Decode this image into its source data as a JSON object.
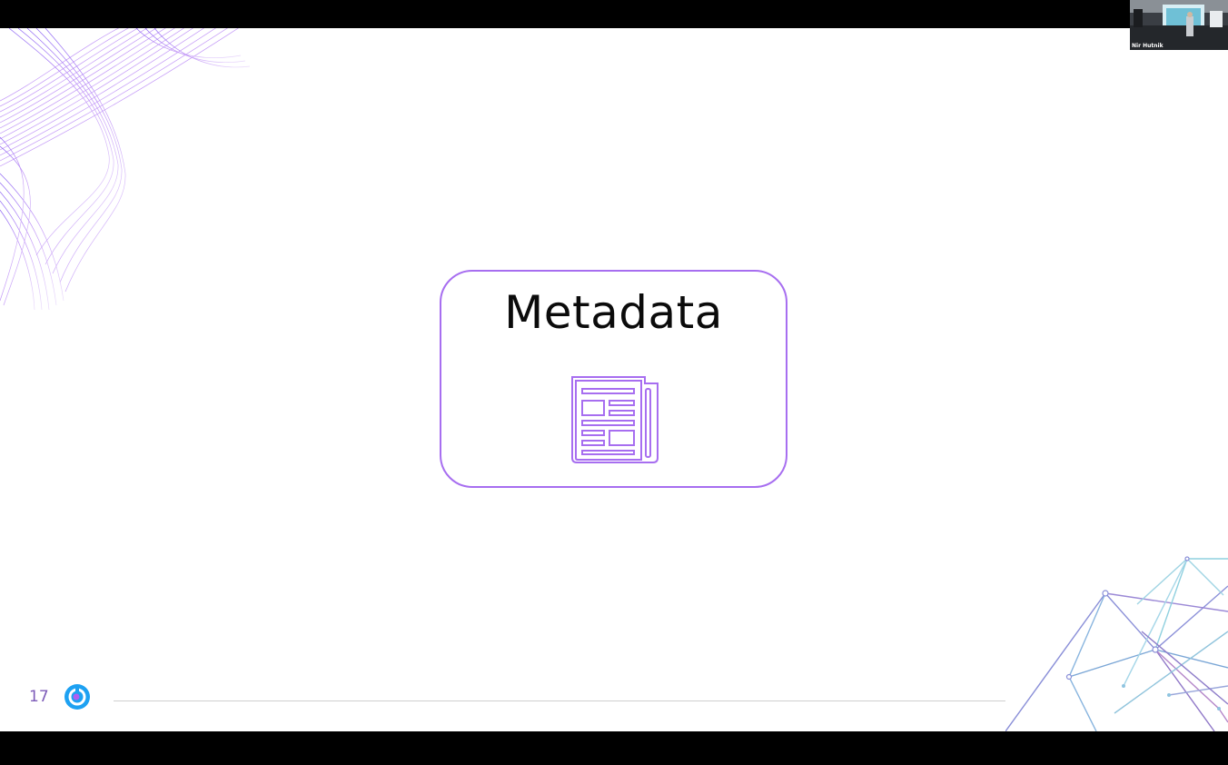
{
  "slide": {
    "title": "Metadata",
    "icon": "newspaper-icon",
    "page_number": "17",
    "accent_color": "#a76ef0"
  },
  "brand": {
    "logo": "brand-logo-icon",
    "color": "#1da1f2"
  },
  "video": {
    "participant_name": "Nir Hutnik"
  }
}
